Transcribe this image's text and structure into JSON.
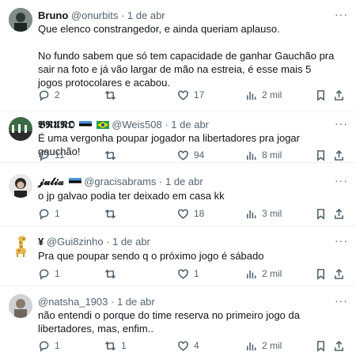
{
  "tweets": [
    {
      "name": "Bruno",
      "handle": "@onurbits",
      "date": "· 1 de abr",
      "text": "Que elenco constrangedor, e ainda queriam aplauso.\n\nNo fundo sabem que só tem capacidade de ganhar Gauchão pra sair na foto e já vão largar de mão na estreia, é esse mais 5 jogos protocolares e acabou.",
      "replies": "2",
      "retweets": "",
      "likes": "17",
      "views": "2 mil"
    },
    {
      "name": "𝕭𝕽𝖀𝕹𝕺",
      "handle": "@Weis508",
      "date": "· 1 de abr",
      "text": "É uma vergonha poupar jogador na libertadores pra jogar gauchão!",
      "replies": "11",
      "retweets": "",
      "likes": "94",
      "views": "8 mil"
    },
    {
      "name": "𝓳𝓾𝓵𝓲𝓪",
      "handle": "@gracisabrams",
      "date": "· 1 de abr",
      "text": "o jp galvao podia ter deixado em casa kk",
      "replies": "1",
      "retweets": "",
      "likes": "18",
      "views": "3 mil"
    },
    {
      "name": "¥",
      "handle": "@Gui8zinho",
      "date": "· 1 de abr",
      "text": "Pra que poupar sendo q o próximo jogo é sábado",
      "replies": "1",
      "retweets": "",
      "likes": "1",
      "views": "2 mil"
    },
    {
      "name": "",
      "handle": "@natsha_1903",
      "date": "· 1 de abr",
      "text": "não entendi o porque do time reserva no primeiro jogo da libertadores, mas, enfim..",
      "replies": "1",
      "retweets": "1",
      "likes": "4",
      "views": "2 mil"
    }
  ],
  "more_label": "···",
  "colors": {
    "text": "#0f1419",
    "secondary": "#536471",
    "divider": "#eff3f4"
  }
}
